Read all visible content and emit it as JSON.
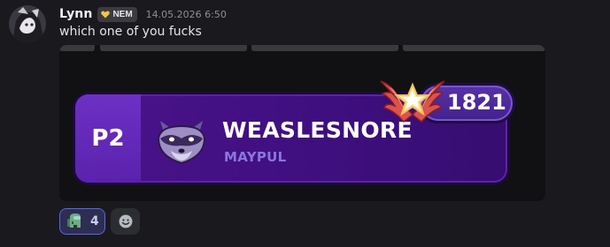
{
  "message": {
    "username": "Lynn",
    "tag_label": "NEM",
    "timestamp": "14.05.2026 6:50",
    "text": "which one of you fucks"
  },
  "embed": {
    "position": "P2",
    "player_name": "WEASLESNORE",
    "team": "MAYPUL",
    "rating": "1821"
  },
  "reactions": [
    {
      "emoji": "among-us-crewmate-icon",
      "count": "4"
    }
  ],
  "colors": {
    "background": "#1a1a1e",
    "card_purple": "#4a148a",
    "accent_blurple": "#5865f2",
    "team_color": "#8a76e0"
  }
}
